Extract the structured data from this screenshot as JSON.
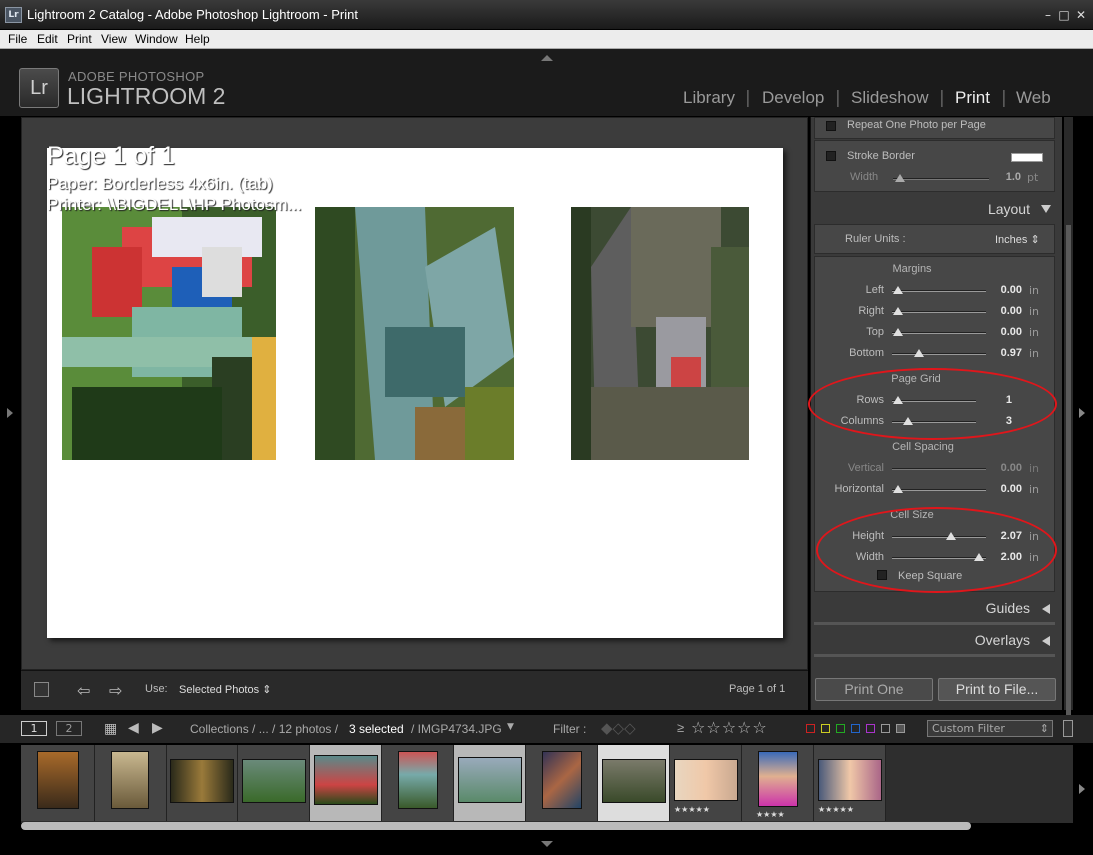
{
  "window": {
    "icon_text": "Lr",
    "title": "Lightroom 2 Catalog - Adobe Photoshop Lightroom - Print",
    "minimize": "–",
    "maximize": "□",
    "close": "✕"
  },
  "menu": [
    "File",
    "Edit",
    "Print",
    "View",
    "Window",
    "Help"
  ],
  "brand": {
    "logo": "Lr",
    "line1": "ADOBE PHOTOSHOP",
    "line2": "LIGHTROOM 2"
  },
  "modules": {
    "library": "Library",
    "develop": "Develop",
    "slideshow": "Slideshow",
    "print": "Print",
    "web": "Web",
    "separator": "|"
  },
  "page_info": {
    "page": "Page 1 of 1",
    "paper": "Paper:  Borderless 4x6in. (tab)",
    "printer": "Printer:  \\\\BIGDELL\\HP Photosm..."
  },
  "panel": {
    "repeat_one": "Repeat One Photo per Page",
    "stroke_border": "Stroke Border",
    "stroke_width_label": "Width",
    "stroke_width_value": "1.0",
    "stroke_width_unit": "pt",
    "stroke_color": "#ffffff",
    "layout_title": "Layout",
    "ruler_units_label": "Ruler Units :",
    "ruler_units_value": "Inches",
    "margins_header": "Margins",
    "margins": [
      {
        "label": "Left",
        "value": "0.00",
        "unit": "in"
      },
      {
        "label": "Right",
        "value": "0.00",
        "unit": "in"
      },
      {
        "label": "Top",
        "value": "0.00",
        "unit": "in"
      },
      {
        "label": "Bottom",
        "value": "0.97",
        "unit": "in"
      }
    ],
    "grid_header": "Page Grid",
    "grid": [
      {
        "label": "Rows",
        "value": "1"
      },
      {
        "label": "Columns",
        "value": "3"
      }
    ],
    "spacing_header": "Cell Spacing",
    "spacing": [
      {
        "label": "Vertical",
        "value": "0.00",
        "unit": "in"
      },
      {
        "label": "Horizontal",
        "value": "0.00",
        "unit": "in"
      }
    ],
    "size_header": "Cell Size",
    "size": [
      {
        "label": "Height",
        "value": "2.07",
        "unit": "in"
      },
      {
        "label": "Width",
        "value": "2.00",
        "unit": "in"
      }
    ],
    "keep_square": "Keep Square",
    "guides_title": "Guides",
    "overlays_title": "Overlays",
    "print_one": "Print One",
    "print_to_file": "Print to File...",
    "highlight_color": "#e0161b"
  },
  "toolbar": {
    "use_label": "Use:",
    "use_value": "Selected Photos",
    "page_count": "Page 1 of 1"
  },
  "filmstrip_bar": {
    "screen1": "1",
    "screen2": "2",
    "path_collections": "Collections / ... / 12 photos /",
    "selected": "3 selected",
    "filename": "/ IMGP4734.JPG",
    "filter_label": "Filter :",
    "rating_op": "≥",
    "stars": "☆☆☆☆☆",
    "custom_filter": "Custom Filter"
  },
  "filmstrip": {
    "stars_5": "★★★★★",
    "stars_4": "★★★★",
    "stars_5b": "★★★★★"
  }
}
